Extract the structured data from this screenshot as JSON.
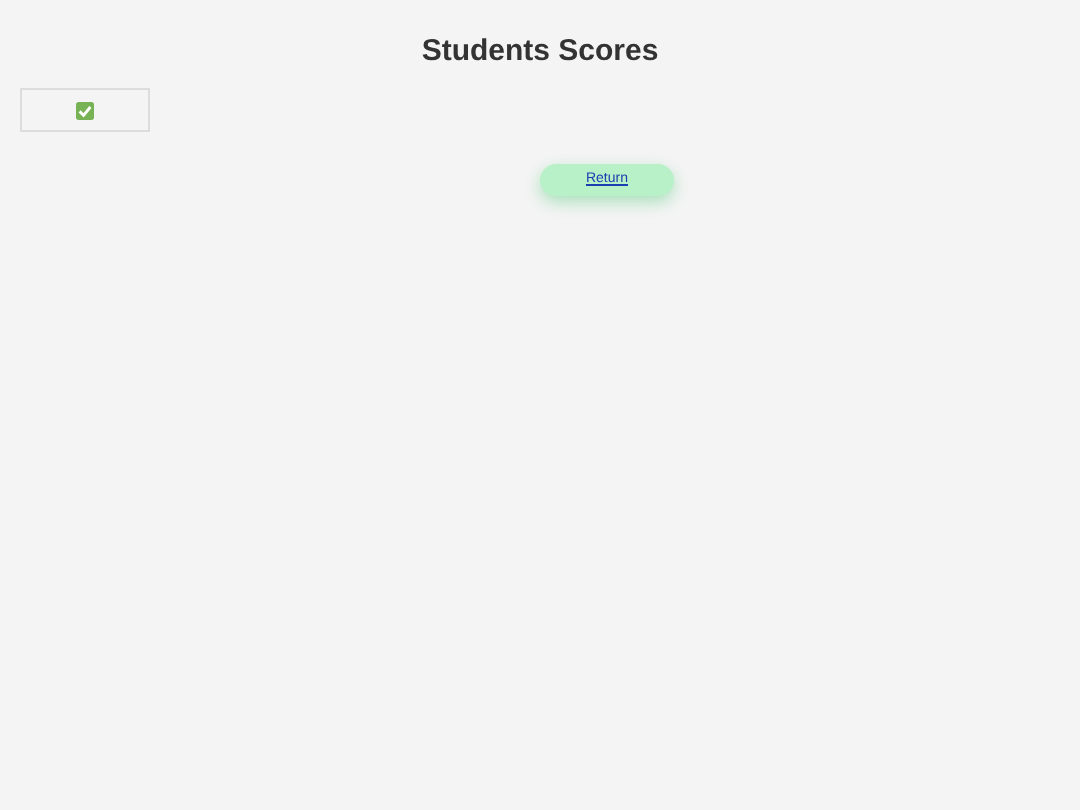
{
  "title": "Students Scores",
  "return_link": "Return"
}
